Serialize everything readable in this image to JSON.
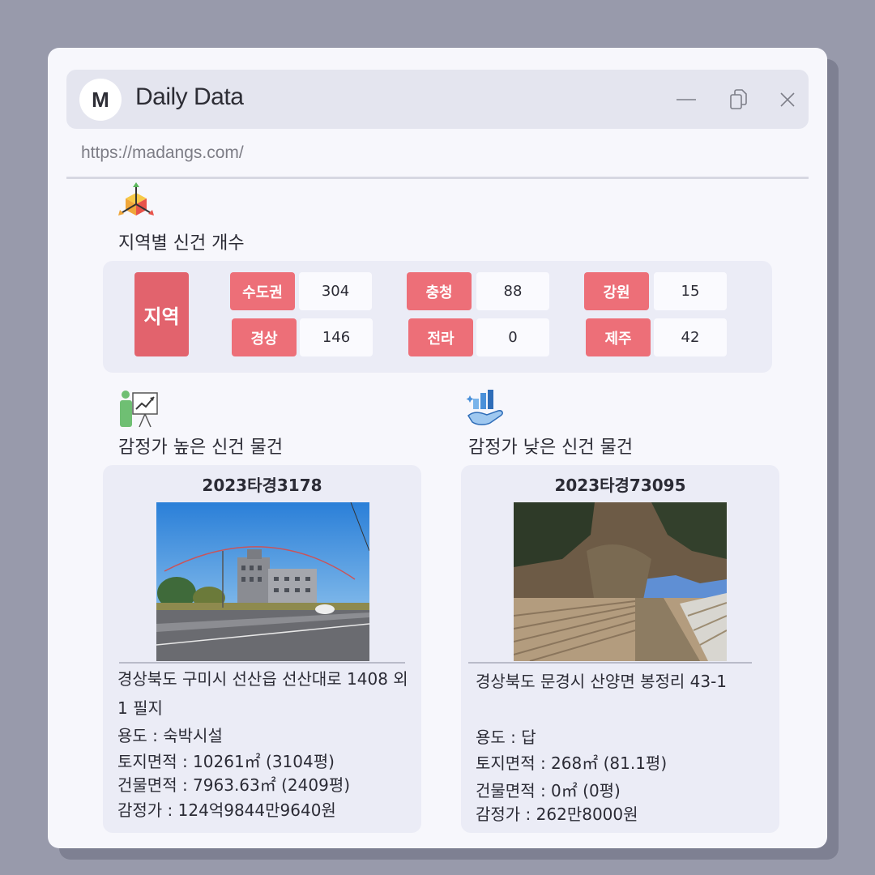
{
  "window": {
    "logo_letter": "M",
    "app_title": "Daily Data",
    "url": "https://madangs.com/",
    "controls": [
      "minimize-icon",
      "copy-icon",
      "close-icon"
    ]
  },
  "region_section": {
    "icon": "axes-cube-icon",
    "title": "지역별 신건 개수",
    "header_label": "지역",
    "regions": [
      {
        "name": "수도권",
        "count": "304"
      },
      {
        "name": "충청",
        "count": "88"
      },
      {
        "name": "강원",
        "count": "15"
      },
      {
        "name": "경상",
        "count": "146"
      },
      {
        "name": "전라",
        "count": "0"
      },
      {
        "name": "제주",
        "count": "42"
      }
    ],
    "colors": {
      "chip": "#ed6f78",
      "header": "#e2636d"
    }
  },
  "high_section": {
    "icon": "presentation-chart-icon",
    "title": "감정가 높은 신건 물건",
    "case_no": "2023타경3178",
    "address": "경상북도 구미시 선산읍 선산대로 1408 외 1 필지",
    "usage": "용도 : 숙박시설",
    "land_area": "토지면적 : 10261㎡ (3104평)",
    "building_area": "건물면적 : 7963.63㎡ (2409평)",
    "appraisal": "감정가 : 124억9844만9640원"
  },
  "low_section": {
    "icon": "hand-bar-chart-icon",
    "title": "감정가 낮은 신건 물건",
    "case_no": "2023타경73095",
    "address": "경상북도 문경시 산양면 봉정리 43-1",
    "usage": "용도 : 답",
    "land_area": "토지면적 : 268㎡ (81.1평)",
    "building_area": "건물면적 : 0㎡ (0평)",
    "appraisal": "감정가 : 262만8000원"
  }
}
